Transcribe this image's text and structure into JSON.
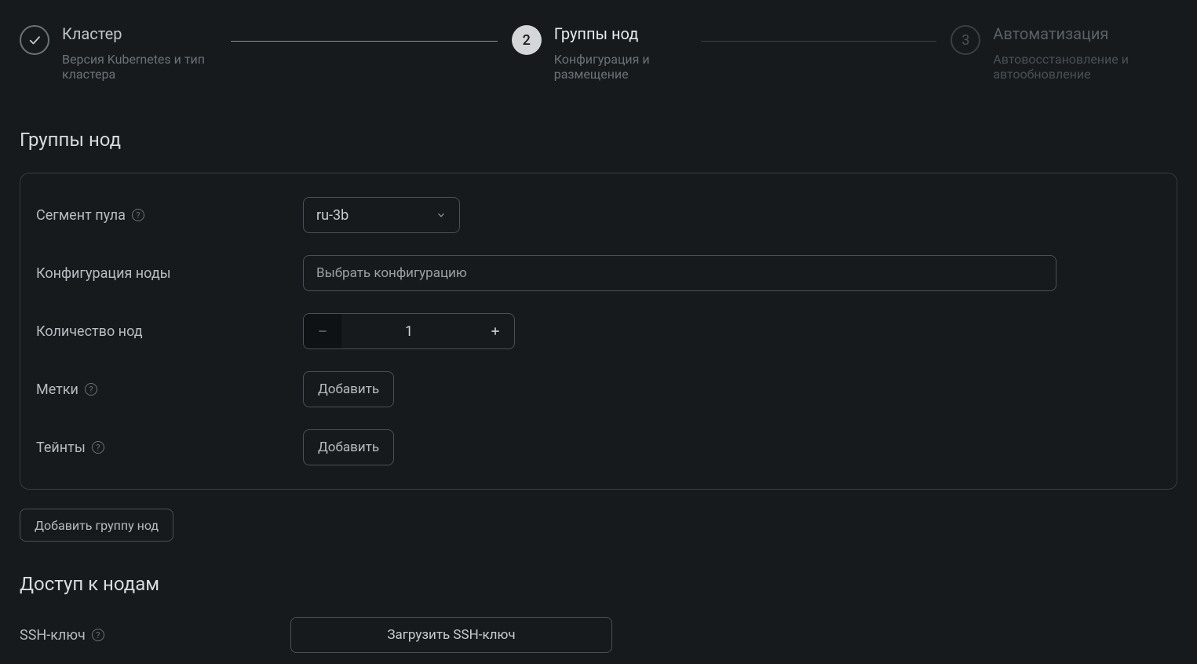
{
  "stepper": {
    "step1": {
      "title": "Кластер",
      "subtitle": "Версия Kubernetes и тип кластера"
    },
    "step2": {
      "number": "2",
      "title": "Группы нод",
      "subtitle": "Конфигурация и размещение"
    },
    "step3": {
      "number": "3",
      "title": "Автоматизация",
      "subtitle": "Автовосстановление и автообновление"
    }
  },
  "section": {
    "nodeGroupsTitle": "Группы нод",
    "accessTitle": "Доступ к нодам"
  },
  "form": {
    "poolSegment": {
      "label": "Сегмент пула",
      "value": "ru-3b"
    },
    "nodeConfig": {
      "label": "Конфигурация ноды",
      "placeholder": "Выбрать конфигурацию"
    },
    "nodeCount": {
      "label": "Количество нод",
      "value": "1"
    },
    "labels": {
      "label": "Метки",
      "button": "Добавить"
    },
    "taints": {
      "label": "Тейнты",
      "button": "Добавить"
    },
    "addGroupButton": "Добавить группу нод"
  },
  "ssh": {
    "label": "SSH-ключ",
    "button": "Загрузить SSH-ключ"
  }
}
